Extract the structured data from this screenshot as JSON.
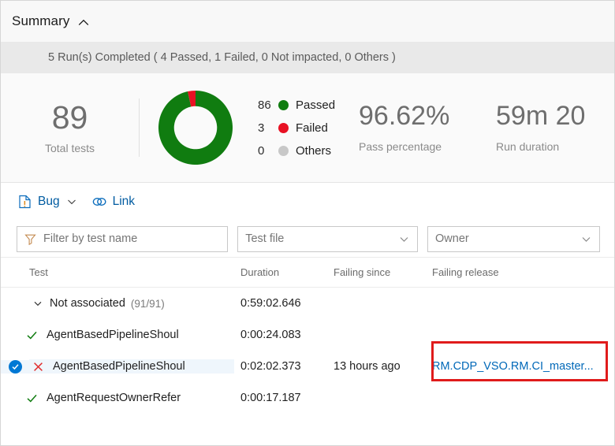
{
  "header": {
    "title": "Summary",
    "collapse_icon": "chevron-up-icon"
  },
  "runs_status": {
    "text": "5 Run(s) Completed ( 4 Passed, 1 Failed, 0 Not impacted, 0 Others )"
  },
  "metrics": {
    "total": {
      "value": "89",
      "caption": "Total tests"
    },
    "pass_percentage": {
      "value": "96.62%",
      "caption": "Pass percentage"
    },
    "run_duration": {
      "value": "59m 20",
      "caption": "Run duration"
    },
    "legend": [
      {
        "count": "86",
        "label": "Passed",
        "color": "#107c10"
      },
      {
        "count": "3",
        "label": "Failed",
        "color": "#e81123"
      },
      {
        "count": "0",
        "label": "Others",
        "color": "#c8c8c8"
      }
    ]
  },
  "chart_data": {
    "type": "pie",
    "title": "",
    "categories": [
      "Passed",
      "Failed",
      "Others"
    ],
    "values": [
      86,
      3,
      0
    ],
    "colors": [
      "#107c10",
      "#e81123",
      "#c8c8c8"
    ],
    "donut": true,
    "inner_radius_ratio": 0.58,
    "legend_position": "right",
    "total": 89
  },
  "toolbar": {
    "bug": {
      "label": "Bug",
      "icon": "bug-document-icon",
      "caret": "chevron-down-icon"
    },
    "link": {
      "label": "Link",
      "icon": "link-icon"
    }
  },
  "filters": {
    "test_name": {
      "placeholder": "Filter by test name",
      "value": "",
      "icon": "funnel-icon"
    },
    "test_file": {
      "label": "Test file",
      "caret": "chevron-down-icon"
    },
    "owner": {
      "label": "Owner",
      "caret": "chevron-down-icon"
    }
  },
  "table": {
    "columns": [
      "Test",
      "Duration",
      "Failing since",
      "Failing release"
    ],
    "rows": [
      {
        "kind": "group",
        "chevron": "chevron-down-icon",
        "name": "Not associated",
        "count": "(91/91)",
        "duration": "0:59:02.646",
        "failing_since": "",
        "failing_release": ""
      },
      {
        "kind": "test",
        "status": "passed",
        "name": "AgentBasedPipelineShoul",
        "duration": "0:00:24.083",
        "failing_since": "",
        "failing_release": ""
      },
      {
        "kind": "test",
        "status": "failed",
        "selected": true,
        "name": "AgentBasedPipelineShoul",
        "duration": "0:02:02.373",
        "failing_since": "13 hours ago",
        "failing_release": "RM.CDP_VSO.RM.CI_master..."
      },
      {
        "kind": "test",
        "status": "passed",
        "name": "AgentRequestOwnerRefer",
        "duration": "0:00:17.187",
        "failing_since": "",
        "failing_release": ""
      }
    ]
  }
}
